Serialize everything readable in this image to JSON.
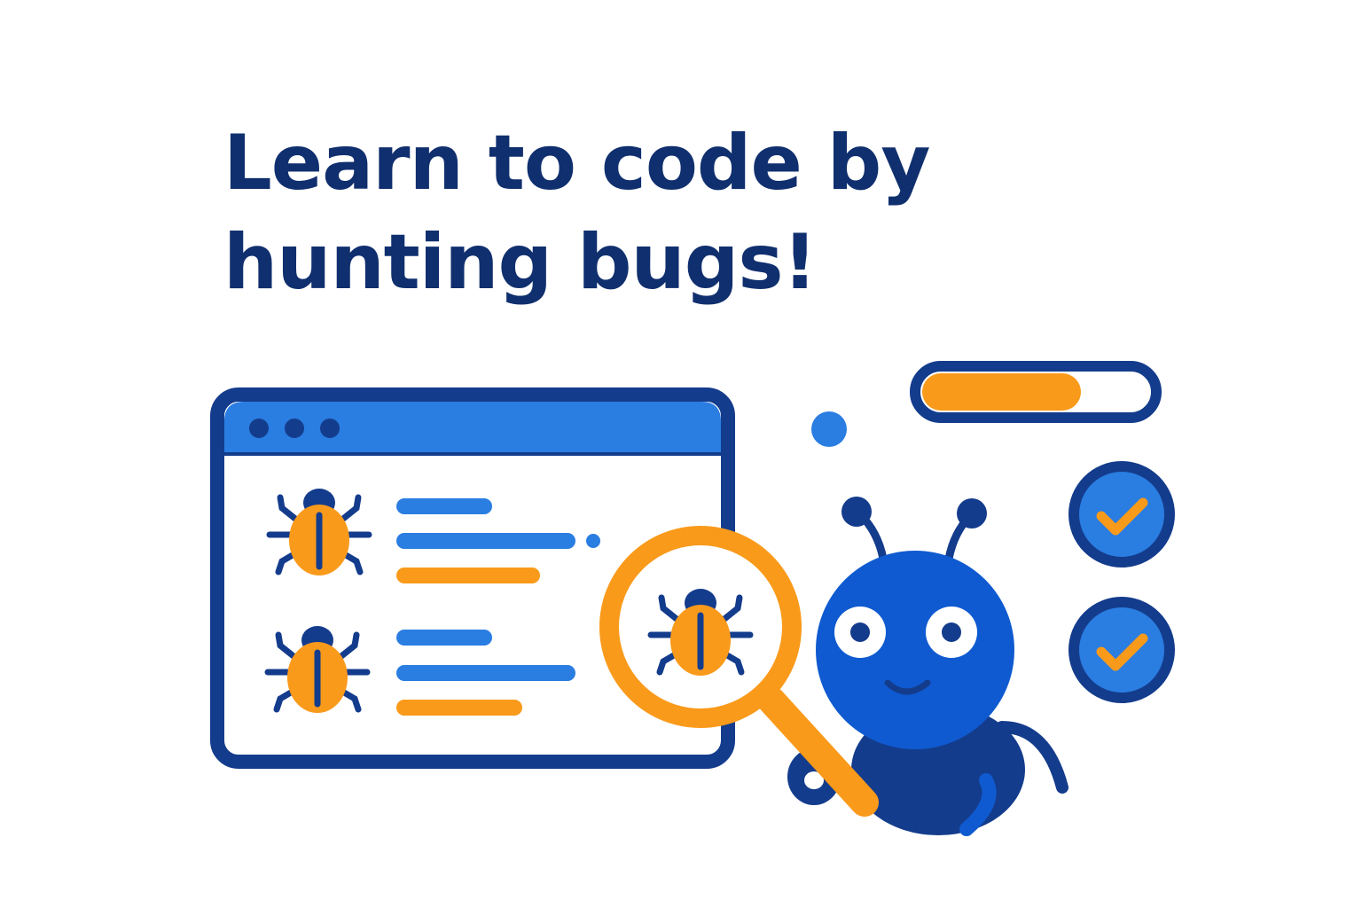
{
  "headline": {
    "line1": "Learn to code by",
    "line2": "hunting bugs!"
  },
  "colors": {
    "navy": "#143c8c",
    "blue": "#2a7de1",
    "mascot_blue": "#0f5ad0",
    "orange": "#f99a1b",
    "text": "#102f6e",
    "white": "#ffffff"
  },
  "icons": {
    "window": "code-window-icon",
    "bug": "bug-icon",
    "magnifier": "magnifying-glass-icon",
    "mascot": "bug-mascot",
    "check": "check-icon"
  },
  "progress": {
    "fraction": 0.7
  },
  "checklist": {
    "count_checked": 2
  }
}
